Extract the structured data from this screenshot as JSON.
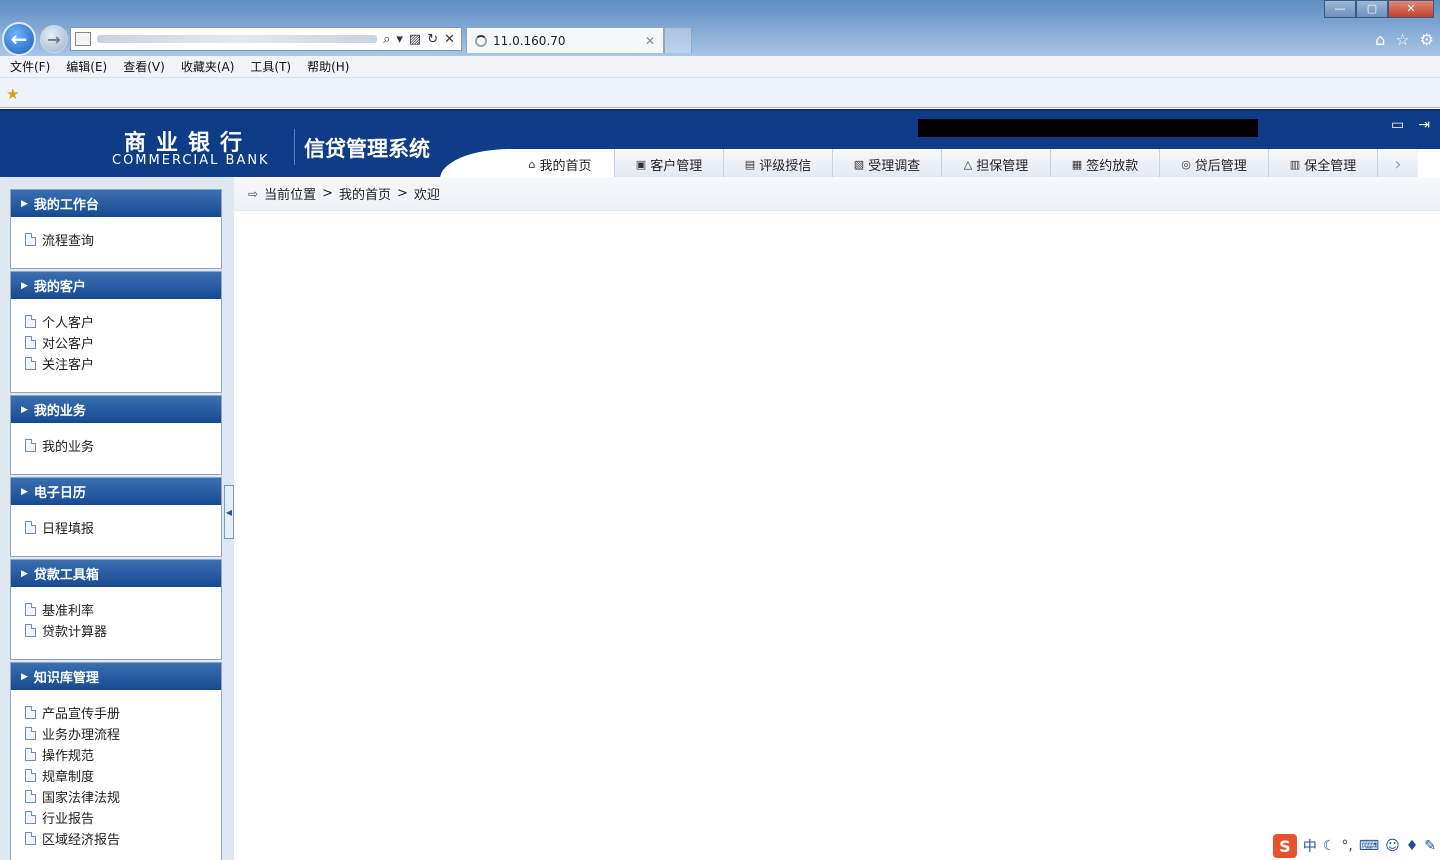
{
  "browser": {
    "tab_title": "11.0.160.70",
    "menu": [
      "文件(F)",
      "编辑(E)",
      "查看(V)",
      "收藏夹(A)",
      "工具(T)",
      "帮助(H)"
    ],
    "window_controls": [
      "—",
      "▢",
      "✕"
    ]
  },
  "app": {
    "logo_cn": "商业银行",
    "logo_en": "COMMERCIAL BANK",
    "system_name": "信贷管理系统",
    "nav_tabs": [
      {
        "label": "我的首页",
        "icon": "home-icon",
        "glyph": "⌂",
        "active": true
      },
      {
        "label": "客户管理",
        "icon": "customer-icon",
        "glyph": "▣",
        "active": false
      },
      {
        "label": "评级授信",
        "icon": "rating-icon",
        "glyph": "▤",
        "active": false
      },
      {
        "label": "受理调查",
        "icon": "survey-icon",
        "glyph": "▧",
        "active": false
      },
      {
        "label": "担保管理",
        "icon": "guarantee-icon",
        "glyph": "△",
        "active": false
      },
      {
        "label": "签约放款",
        "icon": "contract-icon",
        "glyph": "▦",
        "active": false
      },
      {
        "label": "贷后管理",
        "icon": "postloan-icon",
        "glyph": "◎",
        "active": false
      },
      {
        "label": "保全管理",
        "icon": "preserve-icon",
        "glyph": "▥",
        "active": false
      }
    ]
  },
  "sidebar": {
    "panels": [
      {
        "title": "我的工作台",
        "items": [
          "流程查询"
        ]
      },
      {
        "title": "我的客户",
        "items": [
          "个人客户",
          "对公客户",
          "关注客户"
        ]
      },
      {
        "title": "我的业务",
        "items": [
          "我的业务"
        ]
      },
      {
        "title": "电子日历",
        "items": [
          "日程填报"
        ]
      },
      {
        "title": "贷款工具箱",
        "items": [
          "基准利率",
          "贷款计算器"
        ]
      },
      {
        "title": "知识库管理",
        "items": [
          "产品宣传手册",
          "业务办理流程",
          "操作规范",
          "规章制度",
          "国家法律法规",
          "行业报告",
          "区域经济报告"
        ]
      }
    ]
  },
  "breadcrumb": {
    "label": "当前位置",
    "sep": ">",
    "home": "我的首页",
    "current": "欢迎"
  },
  "ime": {
    "logo": "S",
    "mode": "中"
  }
}
